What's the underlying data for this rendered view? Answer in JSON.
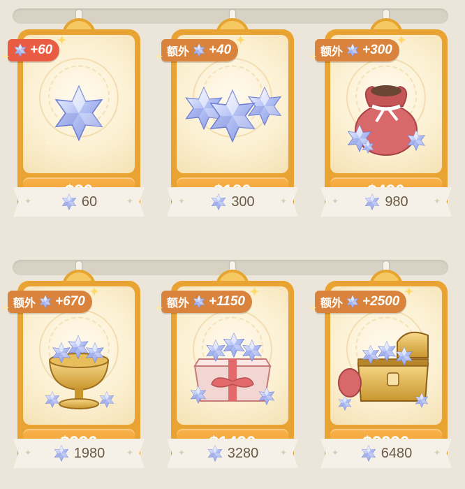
{
  "colors": {
    "background": "#ece6da",
    "frame": "#e9a332",
    "price_button": "#f3a53a",
    "badge_red": "#e95c43",
    "badge_orange": "#d9833c",
    "crystal": "#9fb2ef"
  },
  "rows": [
    {
      "cards": [
        {
          "art": "single-star",
          "badge_type": "red",
          "extra_label": "",
          "bonus": "+60",
          "amount": "60",
          "price": "$30"
        },
        {
          "art": "three-stars",
          "badge_type": "orange",
          "extra_label": "额外",
          "bonus": "+40",
          "amount": "300",
          "price": "$120"
        },
        {
          "art": "pouch",
          "badge_type": "orange",
          "extra_label": "额外",
          "bonus": "+300",
          "amount": "980",
          "price": "$490"
        }
      ]
    },
    {
      "cards": [
        {
          "art": "chalice",
          "badge_type": "orange",
          "extra_label": "额外",
          "bonus": "+670",
          "amount": "1980",
          "price": "$990"
        },
        {
          "art": "gift-box",
          "badge_type": "orange",
          "extra_label": "额外",
          "bonus": "+1150",
          "amount": "3280",
          "price": "$1490"
        },
        {
          "art": "treasure-chest",
          "badge_type": "orange",
          "extra_label": "额外",
          "bonus": "+2500",
          "amount": "6480",
          "price": "$2990"
        }
      ]
    }
  ]
}
